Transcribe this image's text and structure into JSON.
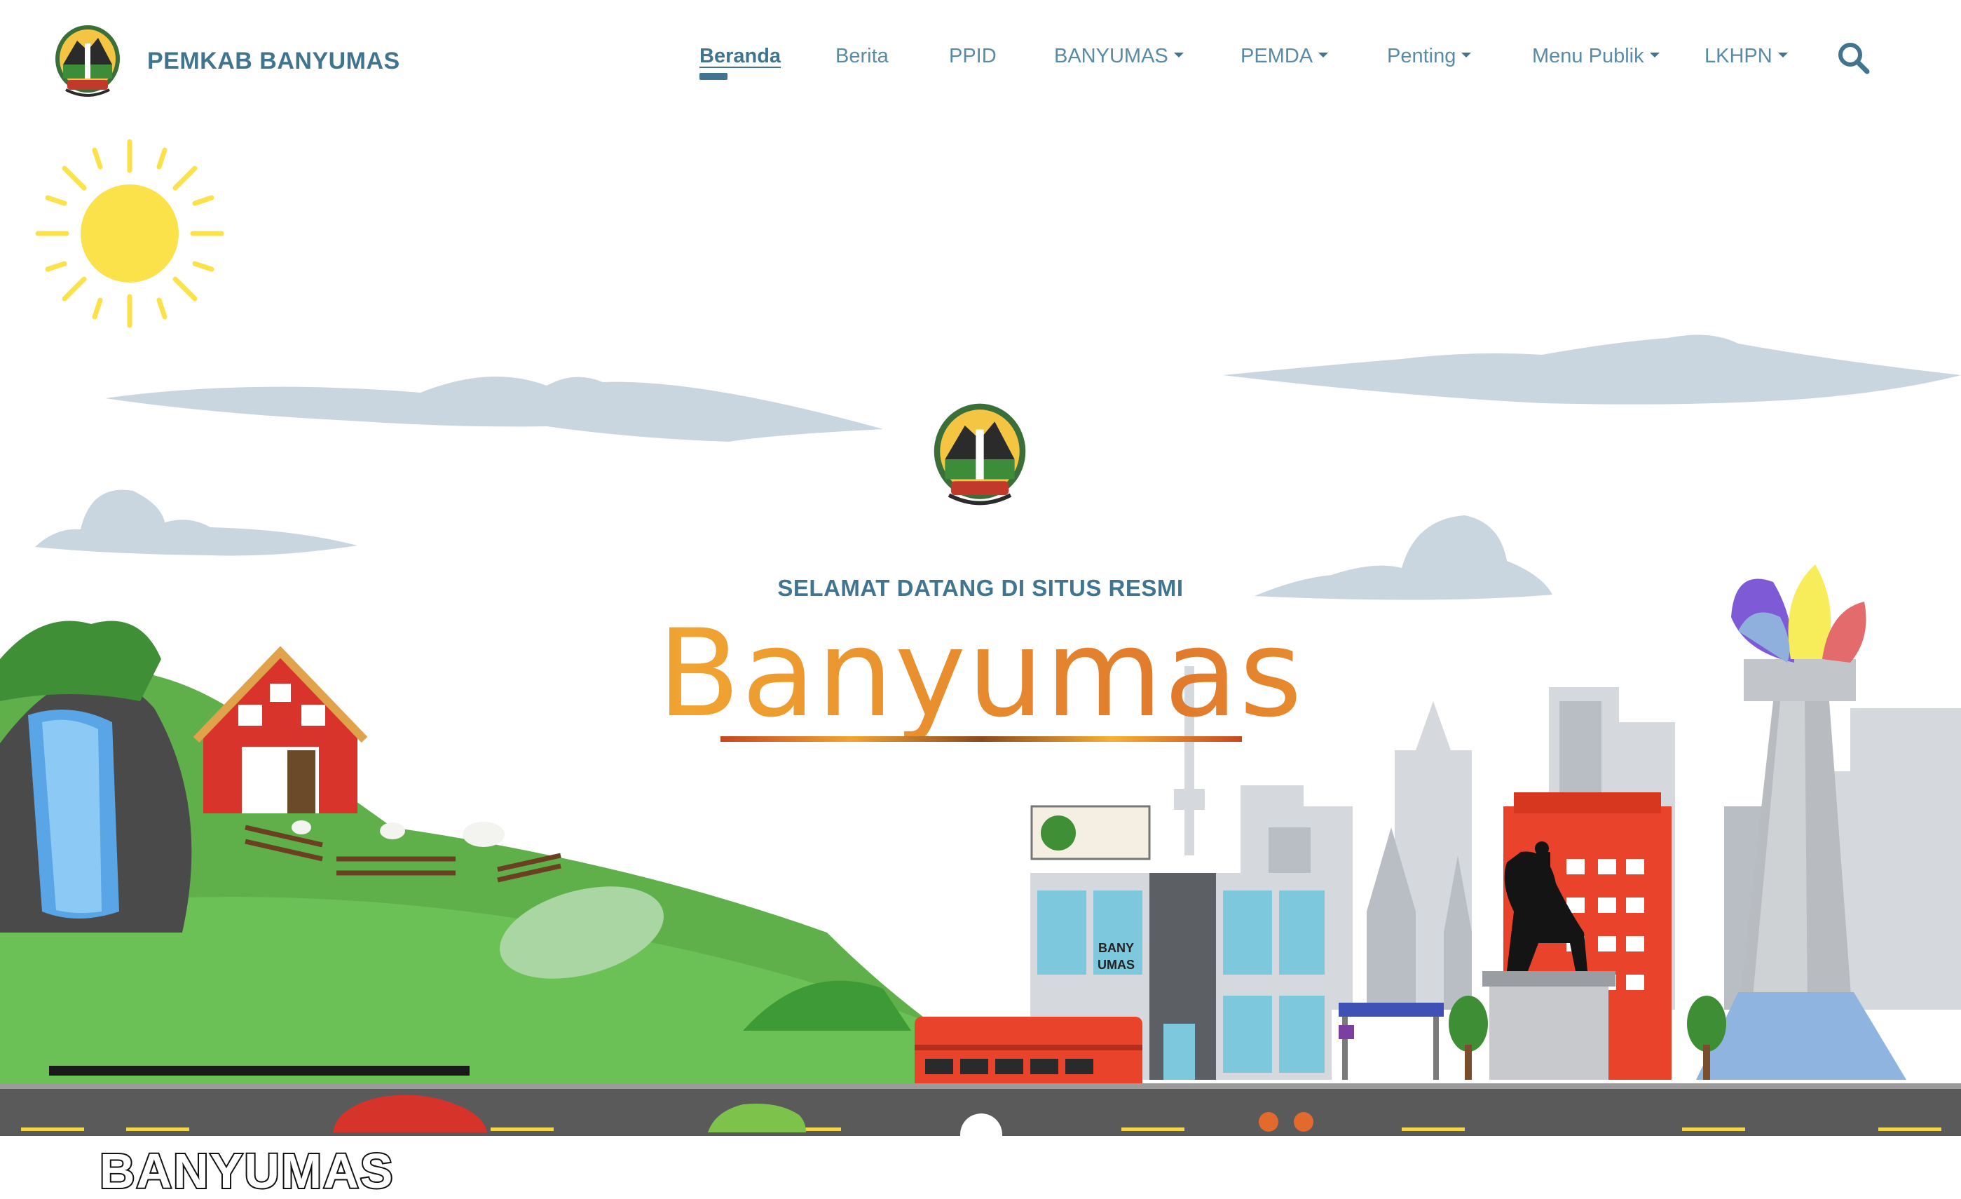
{
  "brand": {
    "name": "PEMKAB BANYUMAS"
  },
  "nav": {
    "items": [
      {
        "label": "Beranda",
        "active": true,
        "dropdown": false
      },
      {
        "label": "Berita",
        "active": false,
        "dropdown": false
      },
      {
        "label": "PPID",
        "active": false,
        "dropdown": false
      },
      {
        "label": "BANYUMAS",
        "active": false,
        "dropdown": true
      },
      {
        "label": "PEMDA",
        "active": false,
        "dropdown": true
      },
      {
        "label": "Penting",
        "active": false,
        "dropdown": true
      },
      {
        "label": "Menu Publik",
        "active": false,
        "dropdown": true
      },
      {
        "label": "LKHPN",
        "active": false,
        "dropdown": true
      }
    ],
    "search_icon": "search-icon"
  },
  "hero": {
    "subtitle": "SELAMAT DATANG DI SITUS RESMI",
    "title": "Banyumas",
    "banner": "BANYUMAS",
    "sign_line1": "BANY",
    "sign_line2": "UMAS"
  },
  "colors": {
    "brand": "#41748e",
    "nav_text": "#5a8aa5",
    "title_orange": "#d5612c",
    "sky_cloud": "#c9d5df",
    "grass": "#5fb04a",
    "road": "#5a5a5a"
  }
}
